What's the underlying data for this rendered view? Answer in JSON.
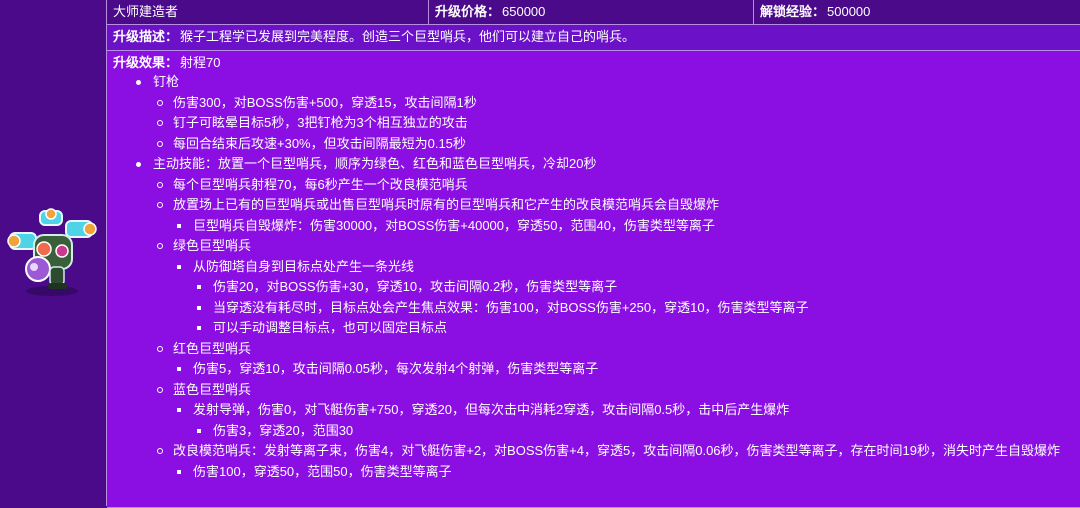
{
  "header": {
    "name": "大师建造者",
    "price_label": "升级价格：",
    "price_value": "650000",
    "unlock_label": "解锁经验：",
    "unlock_value": "500000"
  },
  "description": {
    "label": "升级描述：",
    "text": "猴子工程学已发展到完美程度。创造三个巨型哨兵，他们可以建立自己的哨兵。"
  },
  "effect": {
    "label": "升级效果：",
    "text": "射程70",
    "items": [
      {
        "text": "钉枪",
        "children": [
          {
            "text": "伤害300，对BOSS伤害+500，穿透15，攻击间隔1秒"
          },
          {
            "text": "钉子可眩晕目标5秒，3把钉枪为3个相互独立的攻击"
          },
          {
            "text": "每回合结束后攻速+30%，但攻击间隔最短为0.15秒"
          }
        ]
      },
      {
        "text": "主动技能：放置一个巨型哨兵，顺序为绿色、红色和蓝色巨型哨兵，冷却20秒",
        "children": [
          {
            "text": "每个巨型哨兵射程70，每6秒产生一个改良模范哨兵"
          },
          {
            "text": "放置场上已有的巨型哨兵或出售巨型哨兵时原有的巨型哨兵和它产生的改良模范哨兵会自毁爆炸",
            "children": [
              {
                "text": "巨型哨兵自毁爆炸：伤害30000，对BOSS伤害+40000，穿透50，范围40，伤害类型等离子"
              }
            ]
          },
          {
            "text": "绿色巨型哨兵",
            "children": [
              {
                "text": "从防御塔自身到目标点处产生一条光线",
                "children": [
                  {
                    "text": "伤害20，对BOSS伤害+30，穿透10，攻击间隔0.2秒，伤害类型等离子"
                  },
                  {
                    "text": "当穿透没有耗尽时，目标点处会产生焦点效果：伤害100，对BOSS伤害+250，穿透10，伤害类型等离子"
                  },
                  {
                    "text": "可以手动调整目标点，也可以固定目标点"
                  }
                ]
              }
            ]
          },
          {
            "text": "红色巨型哨兵",
            "children": [
              {
                "text": "伤害5，穿透10，攻击间隔0.05秒，每次发射4个射弹，伤害类型等离子"
              }
            ]
          },
          {
            "text": "蓝色巨型哨兵",
            "children": [
              {
                "text": "发射导弹，伤害0，对飞艇伤害+750，穿透20，但每次击中消耗2穿透，攻击间隔0.5秒，击中后产生爆炸",
                "children": [
                  {
                    "text": "伤害3，穿透20，范围30"
                  }
                ]
              }
            ]
          },
          {
            "text": "改良模范哨兵：发射等离子束，伤害4，对飞艇伤害+2，对BOSS伤害+4，穿透5，攻击间隔0.06秒，伤害类型等离子，存在时间19秒，消失时产生自毁爆炸",
            "children": [
              {
                "text": "伤害100，穿透50，范围50，伤害类型等离子"
              }
            ]
          }
        ]
      }
    ]
  },
  "colors": {
    "header_bg": "#4a0a8a",
    "desc_bg": "#6b12c9",
    "effect_bg": "#8b0fe3",
    "border": "#b78ee0"
  },
  "icons": {
    "avatar": "master-builder-sentry-icon"
  }
}
